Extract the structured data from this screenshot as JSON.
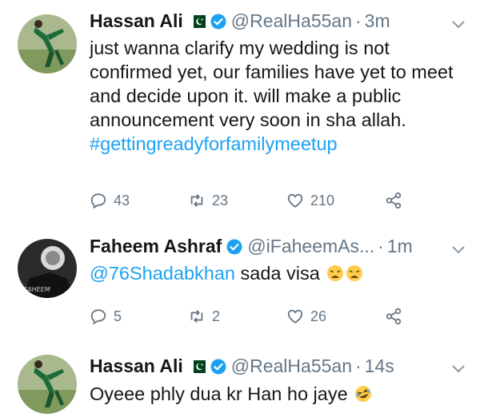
{
  "tweets": [
    {
      "name": "Hassan Ali",
      "handle": "@RealHa55an",
      "time": "3m",
      "text": "just wanna clarify my wedding is not confirmed yet, our families have yet to meet and decide upon it. will make a public announcement very soon in sha allah. ",
      "hashtag": "#gettingreadyforfamilymeetup",
      "replies": "43",
      "retweets": "23",
      "likes": "210"
    },
    {
      "name": "Faheem Ashraf",
      "handle": "@iFaheemAs...",
      "time": "1m",
      "mention": "@76Shadabkhan",
      "text": " sada visa",
      "replies": "5",
      "retweets": "2",
      "likes": "26",
      "avatar_text": "FAHEEM"
    },
    {
      "name": "Hassan Ali",
      "handle": "@RealHa55an",
      "time": "14s",
      "text": "Oyeee phly dua kr Han ho jaye"
    }
  ],
  "separator": "·",
  "icons": [
    "reply-icon",
    "retweet-icon",
    "like-icon",
    "share-icon",
    "verified-badge-icon",
    "pakistan-flag-icon",
    "chevron-down-icon",
    "weary-face-emoji",
    "rofl-emoji"
  ],
  "colors": {
    "link": "#1da1f2",
    "muted": "#657786",
    "text": "#14171a",
    "flag": "#01411c"
  }
}
